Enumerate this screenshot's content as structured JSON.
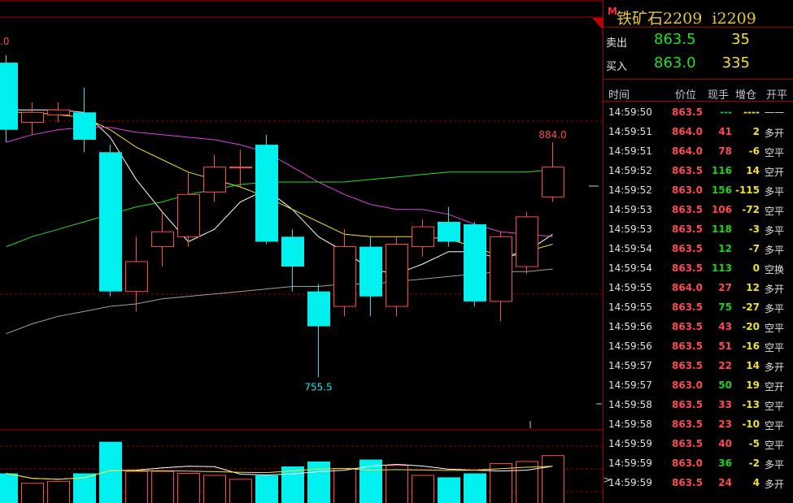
{
  "instrument": {
    "marker": "M",
    "title": "铁矿石2209  i2209"
  },
  "quote": {
    "ask": {
      "label": "卖出",
      "price": "863.5",
      "volume": "35"
    },
    "bid": {
      "label": "买入",
      "price": "863.0",
      "volume": "335"
    }
  },
  "ticks_header": {
    "time": "时间",
    "price": "价位",
    "vol": "现手",
    "chg": "增仓",
    "type": "开平"
  },
  "ticks": [
    {
      "time": "14:59:50",
      "price": "863.5",
      "price_color": "red",
      "vol": "---",
      "vol_color": "green",
      "chg": "----",
      "type": "——",
      "type_color": "white"
    },
    {
      "time": "14:59:51",
      "price": "864.0",
      "price_color": "red",
      "vol": "41",
      "vol_color": "red",
      "chg": "2",
      "type": "多开",
      "type_color": "white"
    },
    {
      "time": "14:59:51",
      "price": "864.0",
      "price_color": "red",
      "vol": "78",
      "vol_color": "red",
      "chg": "-6",
      "type": "空平",
      "type_color": "white"
    },
    {
      "time": "14:59:52",
      "price": "863.5",
      "price_color": "red",
      "vol": "116",
      "vol_color": "green",
      "chg": "14",
      "type": "空开",
      "type_color": "white"
    },
    {
      "time": "14:59:52",
      "price": "863.0",
      "price_color": "red",
      "vol": "156",
      "vol_color": "green",
      "chg": "-115",
      "type": "多平",
      "type_color": "white"
    },
    {
      "time": "14:59:53",
      "price": "863.5",
      "price_color": "red",
      "vol": "106",
      "vol_color": "red",
      "chg": "-72",
      "type": "空平",
      "type_color": "white"
    },
    {
      "time": "14:59:53",
      "price": "863.5",
      "price_color": "red",
      "vol": "118",
      "vol_color": "green",
      "chg": "-3",
      "type": "多平",
      "type_color": "white"
    },
    {
      "time": "14:59:54",
      "price": "863.5",
      "price_color": "red",
      "vol": "12",
      "vol_color": "green",
      "chg": "-7",
      "type": "多平",
      "type_color": "white"
    },
    {
      "time": "14:59:54",
      "price": "863.5",
      "price_color": "red",
      "vol": "113",
      "vol_color": "green",
      "chg": "0",
      "type": "空换",
      "type_color": "white"
    },
    {
      "time": "14:59:55",
      "price": "864.0",
      "price_color": "red",
      "vol": "27",
      "vol_color": "red",
      "chg": "12",
      "type": "多开",
      "type_color": "white"
    },
    {
      "time": "14:59:55",
      "price": "863.5",
      "price_color": "red",
      "vol": "75",
      "vol_color": "green",
      "chg": "-27",
      "type": "多平",
      "type_color": "white"
    },
    {
      "time": "14:59:56",
      "price": "863.5",
      "price_color": "red",
      "vol": "43",
      "vol_color": "red",
      "chg": "-20",
      "type": "空平",
      "type_color": "white"
    },
    {
      "time": "14:59:56",
      "price": "863.5",
      "price_color": "red",
      "vol": "51",
      "vol_color": "red",
      "chg": "-16",
      "type": "空平",
      "type_color": "white"
    },
    {
      "time": "14:59:57",
      "price": "863.5",
      "price_color": "red",
      "vol": "22",
      "vol_color": "red",
      "chg": "14",
      "type": "多开",
      "type_color": "white"
    },
    {
      "time": "14:59:57",
      "price": "863.0",
      "price_color": "red",
      "vol": "50",
      "vol_color": "green",
      "chg": "19",
      "type": "空开",
      "type_color": "white"
    },
    {
      "time": "14:59:58",
      "price": "863.5",
      "price_color": "red",
      "vol": "33",
      "vol_color": "red",
      "chg": "-13",
      "type": "空平",
      "type_color": "white"
    },
    {
      "time": "14:59:58",
      "price": "863.5",
      "price_color": "red",
      "vol": "23",
      "vol_color": "red",
      "chg": "-10",
      "type": "空平",
      "type_color": "white"
    },
    {
      "time": "14:59:59",
      "price": "863.5",
      "price_color": "red",
      "vol": "40",
      "vol_color": "red",
      "chg": "-5",
      "type": "空平",
      "type_color": "white"
    },
    {
      "time": "14:59:59",
      "price": "863.0",
      "price_color": "red",
      "vol": "36",
      "vol_color": "green",
      "chg": "-2",
      "type": "多平",
      "type_color": "white"
    },
    {
      "time": "14:59:59",
      "price": "863.5",
      "price_color": "red",
      "vol": "24",
      "vol_color": "red",
      "chg": "4",
      "type": "多开",
      "type_color": "white"
    }
  ],
  "colors": {
    "up": "#ff4b4b",
    "down": "#00f0f0",
    "ma5": "#ffffff",
    "ma10": "#f0e030",
    "ma20": "#e040e0",
    "ma60": "#20e020",
    "ma120": "#a0a0a0",
    "grid": "#a00000"
  },
  "chart_data": {
    "type": "candlestick",
    "price_axis": {
      "min": 735,
      "max": 900
    },
    "labels": {
      "high": "884.0",
      "low": "755.5",
      "corner": ".0"
    },
    "candles": [
      {
        "o": 882,
        "c": 855,
        "h": 885,
        "l": 850
      },
      {
        "o": 858,
        "c": 862,
        "h": 866,
        "l": 853
      },
      {
        "o": 861,
        "c": 863,
        "h": 866,
        "l": 858
      },
      {
        "o": 862,
        "c": 851,
        "h": 872,
        "l": 846
      },
      {
        "o": 846,
        "c": 790,
        "h": 849,
        "l": 788
      },
      {
        "o": 790,
        "c": 802,
        "h": 812,
        "l": 782
      },
      {
        "o": 808,
        "c": 814,
        "h": 822,
        "l": 800
      },
      {
        "o": 812,
        "c": 829,
        "h": 838,
        "l": 808
      },
      {
        "o": 830,
        "c": 840,
        "h": 845,
        "l": 826
      },
      {
        "o": 840,
        "c": 840,
        "h": 847,
        "l": 832
      },
      {
        "o": 849,
        "c": 810,
        "h": 853,
        "l": 809
      },
      {
        "o": 812,
        "c": 800,
        "h": 815,
        "l": 790
      },
      {
        "o": 790,
        "c": 776,
        "h": 793,
        "l": 755.5
      },
      {
        "o": 784,
        "c": 808,
        "h": 815,
        "l": 780
      },
      {
        "o": 808,
        "c": 788,
        "h": 812,
        "l": 780
      },
      {
        "o": 784,
        "c": 809,
        "h": 812,
        "l": 780
      },
      {
        "o": 808,
        "c": 816,
        "h": 819,
        "l": 804
      },
      {
        "o": 818,
        "c": 810,
        "h": 824,
        "l": 808
      },
      {
        "o": 817,
        "c": 786,
        "h": 818,
        "l": 784
      },
      {
        "o": 786,
        "c": 812,
        "h": 814,
        "l": 778
      },
      {
        "o": 800,
        "c": 820,
        "h": 822,
        "l": 797
      },
      {
        "o": 828,
        "c": 840,
        "h": 850,
        "l": 826
      }
    ],
    "volumes": [
      30,
      20,
      22,
      30,
      62,
      32,
      32,
      30,
      28,
      24,
      28,
      37,
      42,
      35,
      44,
      38,
      28,
      26,
      30,
      40,
      42,
      48
    ],
    "ma_lines": [
      {
        "name": "MA5",
        "values": [
          863,
          863,
          863,
          862,
          852,
          835,
          822,
          810,
          815,
          826,
          831,
          823,
          812,
          806,
          799,
          797,
          801,
          806,
          806,
          803,
          806,
          813
        ]
      },
      {
        "name": "MA10",
        "values": [
          862,
          862,
          861,
          860,
          855,
          848,
          843,
          838,
          835,
          832,
          828,
          823,
          818,
          813,
          812,
          812,
          812,
          811,
          808,
          804,
          806,
          809
        ]
      },
      {
        "name": "MA20",
        "values": [
          850,
          853,
          855,
          856,
          856,
          854,
          853,
          852,
          851,
          849,
          846,
          840,
          834,
          829,
          825,
          823,
          823,
          821,
          817,
          814,
          813,
          812
        ]
      },
      {
        "name": "MA60",
        "values": [
          808,
          812,
          815,
          818,
          821,
          824,
          826,
          829,
          831,
          833,
          834,
          834,
          834,
          834,
          835,
          836,
          837,
          838,
          838,
          838,
          838,
          839
        ]
      },
      {
        "name": "MA120",
        "values": [
          773,
          777,
          780,
          782,
          784,
          785,
          787,
          788,
          789,
          790,
          791,
          792,
          792,
          793,
          793,
          794,
          795,
          796,
          797,
          798,
          798,
          799
        ]
      }
    ]
  }
}
